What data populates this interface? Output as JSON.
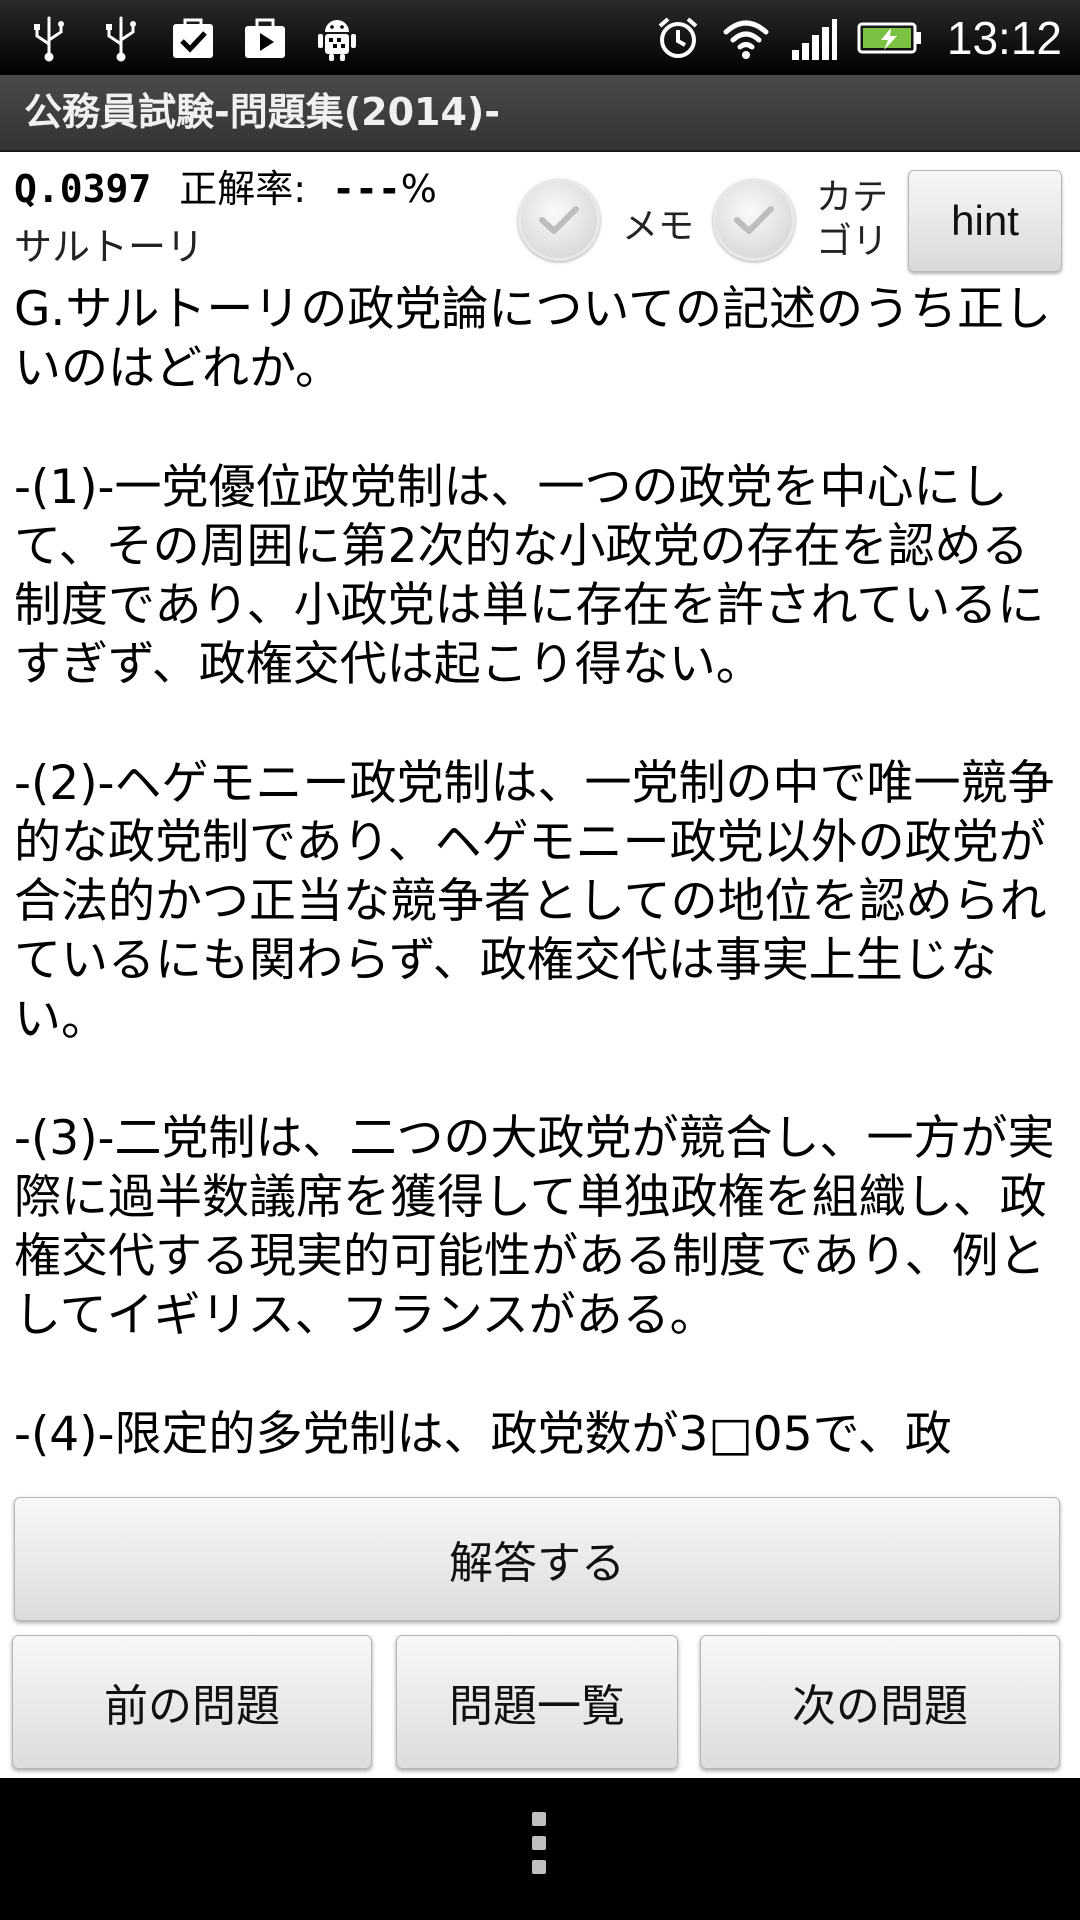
{
  "status_bar": {
    "left_icons": [
      "usb-icon",
      "usb-icon",
      "task-check-icon",
      "play-store-icon",
      "android-debug-icon"
    ],
    "right_icons": [
      "alarm-icon",
      "wifi-icon",
      "signal-icon",
      "battery-charging-icon"
    ],
    "time": "13:12"
  },
  "app": {
    "title": "公務員試験-問題集(2014)-"
  },
  "question": {
    "number": "Q.0397",
    "rate_label": "正解率:",
    "rate_value": "---",
    "rate_unit": "%",
    "category": "サルトーリ",
    "memo_label": "メモ",
    "category_check_label": "カテ\nゴリ",
    "hint_label": "hint",
    "stem": "G.サルトーリの政党論についての記述のうち正しいのはどれか。",
    "options": [
      "-(1)-一党優位政党制は、一つの政党を中心にして、その周囲に第2次的な小政党の存在を認める制度であり、小政党は単に存在を許されているにすぎず、政権交代は起こり得ない。",
      "-(2)-ヘゲモニー政党制は、一党制の中で唯一競争的な政党制であり、ヘゲモニー政党以外の政党が合法的かつ正当な競争者としての地位を認められているにも関わらず、政権交代は事実上生じない。",
      "-(3)-二党制は、二つの大政党が競合し、一方が実際に過半数議席を獲得して単独政権を組織し、政権交代する現実的可能性がある制度であり、例としてイギリス、フランスがある。",
      "-(4)-限定的多党制は、政党数が3□05で、政"
    ]
  },
  "buttons": {
    "answer": "解答する",
    "prev": "前の問題",
    "list": "問題一覧",
    "next": "次の問題"
  }
}
